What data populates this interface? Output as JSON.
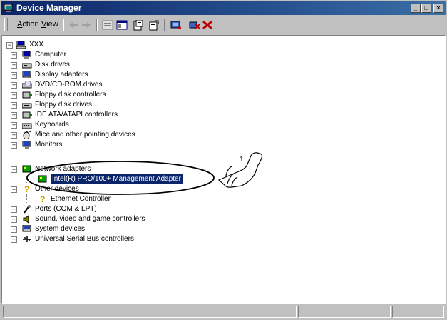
{
  "window": {
    "title": "Device Manager"
  },
  "titlebar_buttons": {
    "minimize": "_",
    "maximize": "□",
    "close": "×"
  },
  "menu": {
    "action": "Action",
    "view": "View"
  },
  "toolbar": {
    "icons": [
      "back-arrow-icon",
      "forward-arrow-icon",
      "up-level-icon",
      "show-hide-tree-icon",
      "properties-icon",
      "help-icon",
      "scan-hardware-icon",
      "uninstall-icon",
      "disable-icon"
    ]
  },
  "tree": {
    "root": "XXX",
    "items": [
      {
        "label": "Computer",
        "icon": "computer-icon"
      },
      {
        "label": "Disk drives",
        "icon": "disk-drive-icon"
      },
      {
        "label": "Display adapters",
        "icon": "display-adapter-icon"
      },
      {
        "label": "DVD/CD-ROM drives",
        "icon": "cdrom-icon"
      },
      {
        "label": "Floppy disk controllers",
        "icon": "floppy-controller-icon"
      },
      {
        "label": "Floppy disk drives",
        "icon": "floppy-drive-icon"
      },
      {
        "label": "IDE ATA/ATAPI controllers",
        "icon": "ide-controller-icon"
      },
      {
        "label": "Keyboards",
        "icon": "keyboard-icon"
      },
      {
        "label": "Mice and other pointing devices",
        "icon": "mouse-icon"
      },
      {
        "label": "Monitors",
        "icon": "monitor-icon"
      },
      {
        "label": "Network adapters",
        "icon": "network-adapter-icon",
        "expanded": true,
        "children": [
          {
            "label": "Intel(R) PRO/100+ Management Adapter",
            "selected": true,
            "icon": "network-card-icon"
          }
        ]
      },
      {
        "label": "Other devices",
        "icon": "unknown-device-icon",
        "expanded": true,
        "children": [
          {
            "label": "Ethernet Controller",
            "icon": "question-device-icon"
          }
        ]
      },
      {
        "label": "Ports (COM & LPT)",
        "icon": "port-icon"
      },
      {
        "label": "Sound, video and game controllers",
        "icon": "sound-icon"
      },
      {
        "label": "System devices",
        "icon": "system-device-icon"
      },
      {
        "label": "Universal Serial Bus controllers",
        "icon": "usb-icon"
      }
    ]
  },
  "annotation": {
    "callout_number": "1"
  }
}
